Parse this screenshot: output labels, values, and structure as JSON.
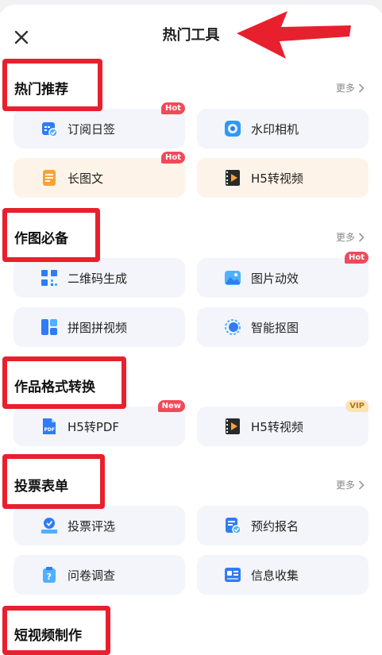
{
  "header": {
    "title": "热门工具"
  },
  "sections": [
    {
      "title": "热门推荐",
      "more": "更多",
      "items": [
        {
          "label": "订阅日签",
          "badge": "Hot",
          "icon": "calendar-check-icon"
        },
        {
          "label": "水印相机",
          "badge": "",
          "icon": "camera-icon"
        },
        {
          "label": "长图文",
          "badge": "Hot",
          "icon": "document-icon"
        },
        {
          "label": "H5转视频",
          "badge": "",
          "icon": "video-film-icon"
        }
      ]
    },
    {
      "title": "作图必备",
      "more": "更多",
      "items": [
        {
          "label": "二维码生成",
          "badge": "",
          "icon": "qr-code-icon"
        },
        {
          "label": "图片动效",
          "badge": "Hot",
          "icon": "image-icon"
        },
        {
          "label": "拼图拼视频",
          "badge": "",
          "icon": "collage-icon"
        },
        {
          "label": "智能抠图",
          "badge": "",
          "icon": "cutout-icon"
        }
      ]
    },
    {
      "title": "作品格式转换",
      "more": "",
      "items": [
        {
          "label": "H5转PDF",
          "badge": "New",
          "icon": "pdf-icon"
        },
        {
          "label": "H5转视频",
          "badge": "VIP",
          "icon": "video-film-icon"
        }
      ]
    },
    {
      "title": "投票表单",
      "more": "更多",
      "items": [
        {
          "label": "投票评选",
          "badge": "",
          "icon": "vote-icon"
        },
        {
          "label": "预约报名",
          "badge": "",
          "icon": "form-check-icon"
        },
        {
          "label": "问卷调查",
          "badge": "",
          "icon": "questionnaire-icon"
        },
        {
          "label": "信息收集",
          "badge": "",
          "icon": "id-card-icon"
        }
      ]
    },
    {
      "title": "短视频制作",
      "more": "",
      "items": []
    }
  ],
  "colors": {
    "accent": "#2f7cf6",
    "highlight": "#e8202d",
    "hot_badge": "#f04a5a",
    "card_bg": "#f3f5fb",
    "card_warm_bg": "#fdf3e9"
  }
}
